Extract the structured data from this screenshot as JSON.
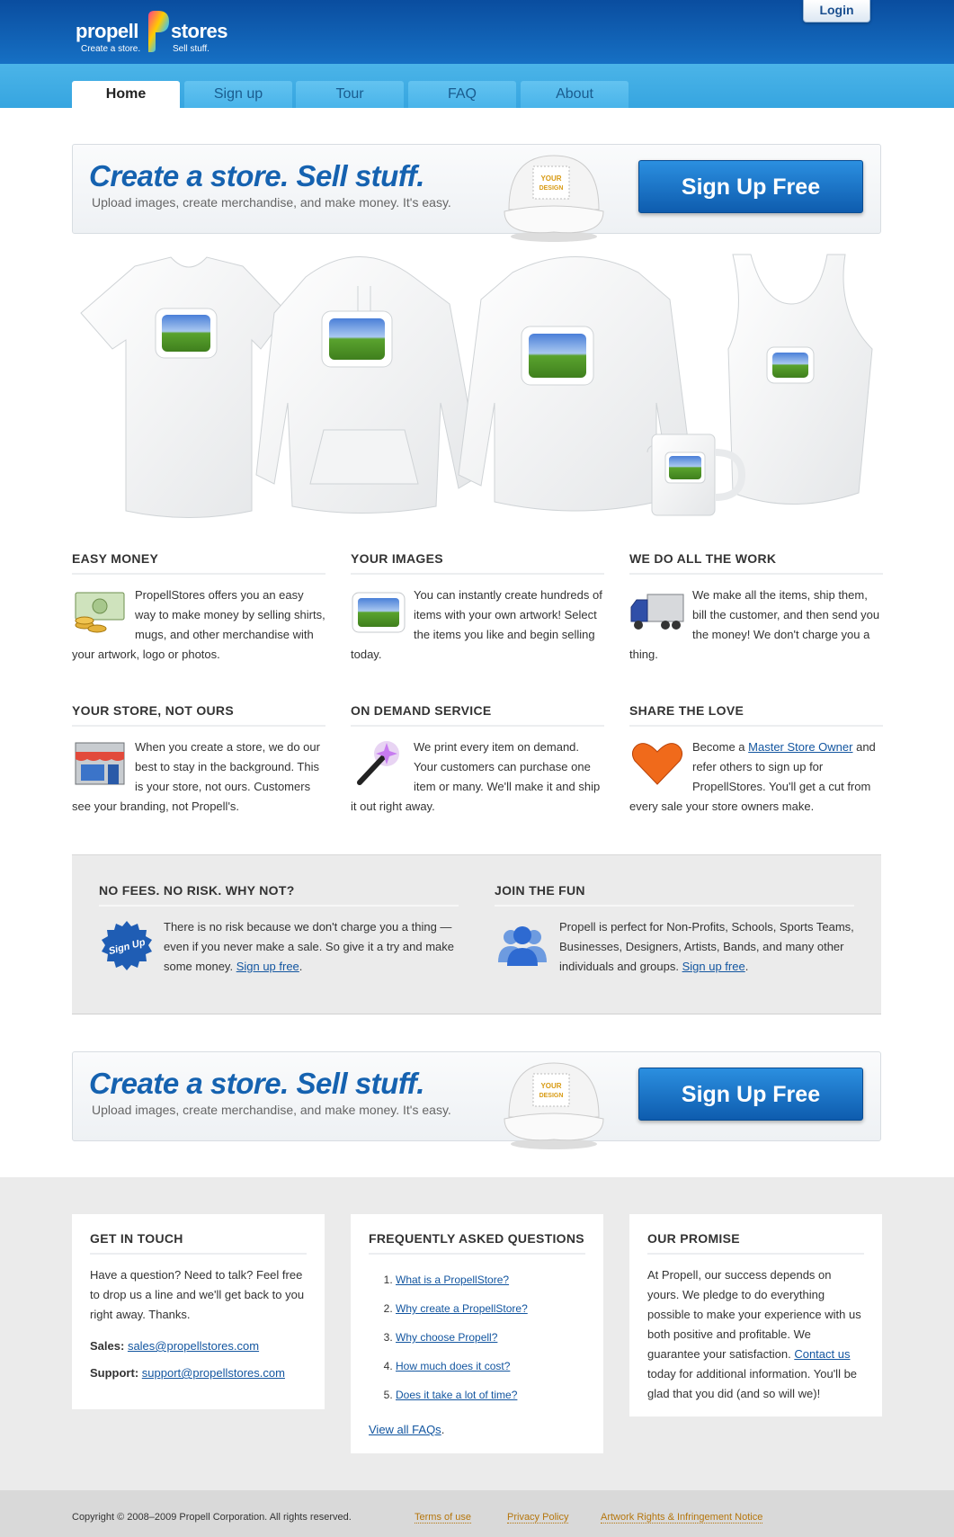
{
  "header": {
    "logo_word_1": "propell",
    "logo_word_2": "stores",
    "tagline_1": "Create a store.",
    "tagline_2": "Sell stuff.",
    "login_label": "Login"
  },
  "nav": {
    "tabs": [
      {
        "label": "Home",
        "active": true
      },
      {
        "label": "Sign up",
        "active": false
      },
      {
        "label": "Tour",
        "active": false
      },
      {
        "label": "FAQ",
        "active": false
      },
      {
        "label": "About",
        "active": false
      }
    ]
  },
  "banner": {
    "headline": "Create a store. Sell stuff.",
    "subtext": "Upload images, create merchandise, and make money. It's easy.",
    "cap_text_1": "YOUR",
    "cap_text_2": "DESIGN",
    "button_label": "Sign Up Free"
  },
  "features": [
    {
      "title": "EASY MONEY",
      "icon": "money-icon",
      "text": "PropellStores offers you an easy way to make money by selling shirts, mugs, and other merchandise with your artwork, logo or photos."
    },
    {
      "title": "YOUR IMAGES",
      "icon": "image-icon",
      "text": "You can instantly create hundreds of items with your own artwork! Select the items you like and begin selling today."
    },
    {
      "title": "WE DO ALL THE WORK",
      "icon": "truck-icon",
      "text": "We make all the items, ship them, bill the customer, and then send you the money! We don't charge you a thing."
    },
    {
      "title": "YOUR STORE, NOT OURS",
      "icon": "storefront-icon",
      "text": "When you create a store, we do our best to stay in the background. This is your store, not ours. Customers see your branding, not Propell's."
    },
    {
      "title": "ON DEMAND SERVICE",
      "icon": "magic-wand-icon",
      "text": "We print every item on demand. Your customers can purchase one item or many. We'll make it and ship it out right away."
    },
    {
      "title": "SHARE THE LOVE",
      "icon": "heart-icon",
      "text_before": "Become a ",
      "link": "Master Store Owner",
      "text_after": " and refer others to sign up for PropellStores. You'll get a cut from every sale your store owners make."
    }
  ],
  "band": {
    "left": {
      "title": "NO FEES. NO RISK. WHY NOT?",
      "badge": "Sign Up",
      "text": "There is no risk because we don't charge you a thing — even if you never make a sale. So give it a try and make some money. ",
      "link": "Sign up free",
      "end": "."
    },
    "right": {
      "title": "JOIN THE FUN",
      "text": "Propell is perfect for Non-Profits, Schools, Sports Teams, Businesses, Designers, Artists, Bands, and many other individuals and groups. ",
      "link": "Sign up free",
      "end": "."
    }
  },
  "footer": {
    "contact": {
      "title": "GET IN TOUCH",
      "text": "Have a question? Need to talk? Feel free to drop us a line and we'll get back to you right away. Thanks.",
      "sales_label": "Sales:",
      "sales_email": "sales@propellstores.com",
      "support_label": "Support:",
      "support_email": "support@propellstores.com"
    },
    "faq": {
      "title": "FREQUENTLY ASKED QUESTIONS",
      "items": [
        "What is a PropellStore?",
        "Why create a PropellStore?",
        "Why choose Propell?",
        "How much does it cost?",
        "Does it take a lot of time?"
      ],
      "view_all": "View all FAQs",
      "view_all_end": "."
    },
    "promise": {
      "title": "OUR PROMISE",
      "text_before": "At Propell, our success depends on yours. We pledge to do everything possible to make your experience with us both positive and profitable. We guarantee your satisfaction. ",
      "link": "Contact us",
      "text_after": " today for additional information. You'll be glad that you did (and so will we)!"
    }
  },
  "copyright": {
    "text": "Copyright © 2008–2009 Propell Corporation. All rights reserved.",
    "links": [
      "Terms of use",
      "Privacy Policy",
      "Artwork Rights & Infringement Notice"
    ]
  },
  "colors": {
    "header_blue": "#0a4d9f",
    "nav_blue": "#3fabe4",
    "button_blue": "#1466b8",
    "link_orange": "#b5760d"
  }
}
